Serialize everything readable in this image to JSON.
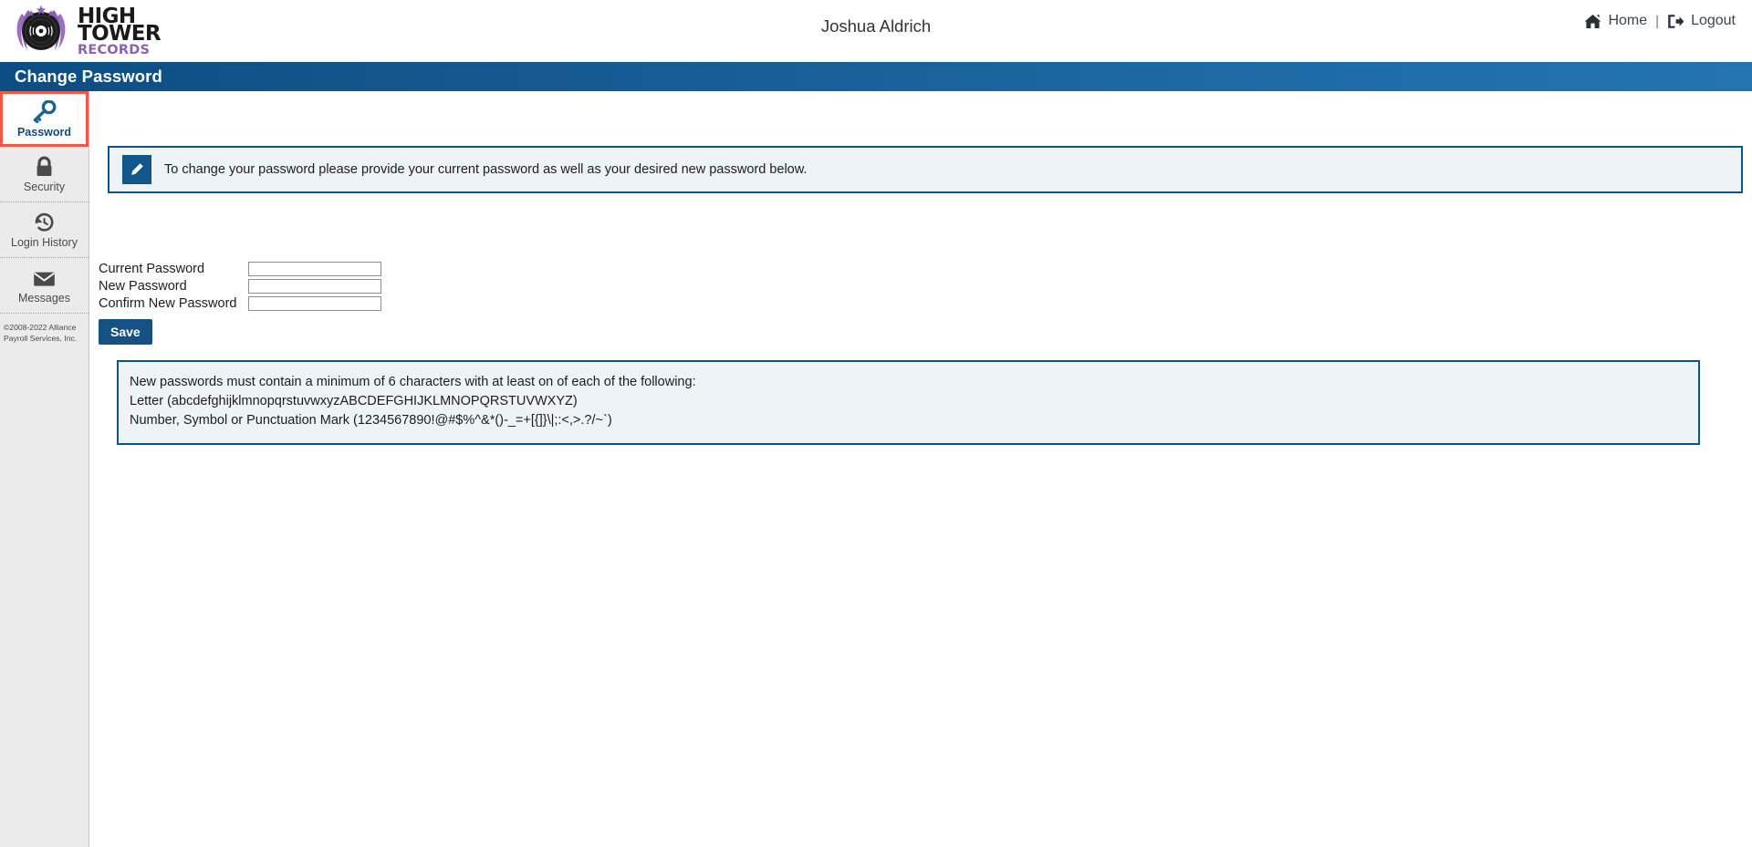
{
  "header": {
    "logo": {
      "line1": "HIGH",
      "line2": "TOWER",
      "line3": "RECORDS",
      "icon": "vinyl-record-icon",
      "purple": "#8a63ad"
    },
    "user_name": "Joshua Aldrich",
    "home_label": "Home",
    "home_icon": "home-icon",
    "divider": "|",
    "logout_label": "Logout",
    "logout_icon": "logout-icon"
  },
  "page": {
    "title": "Change Password",
    "title_bar_color": "#0c4d84"
  },
  "sidebar": {
    "items": [
      {
        "label": "Password",
        "icon": "key-icon",
        "active": true
      },
      {
        "label": "Security",
        "icon": "lock-icon",
        "active": false
      },
      {
        "label": "Login History",
        "icon": "history-clock-icon",
        "active": false
      },
      {
        "label": "Messages",
        "icon": "envelope-icon",
        "active": false
      }
    ],
    "active_outline_color": "#f4564a",
    "copyright": "©2008-2022 Alliance Payroll Services, Inc."
  },
  "banner": {
    "icon": "pencil-edit-icon",
    "text": "To change your password please provide your current password as well as your desired new password below.",
    "border_color": "#0d5487",
    "fill_color": "#eef3f8"
  },
  "form": {
    "fields": [
      {
        "label": "Current Password",
        "value": "",
        "placeholder": ""
      },
      {
        "label": "New Password",
        "value": "",
        "placeholder": ""
      },
      {
        "label": "Confirm New Password",
        "value": "",
        "placeholder": ""
      }
    ],
    "save_label": "Save",
    "save_color": "#165184"
  },
  "requirements": {
    "lines": [
      "New passwords must contain a minimum of 6 characters with at least on of each of the following:",
      "Letter (abcdefghijklmnopqrstuvwxyzABCDEFGHIJKLMNOPQRSTUVWXYZ)",
      "Number, Symbol or Punctuation Mark (1234567890!@#$%^&*()-_=+[{]}\\|;:<,>.?/~`)"
    ],
    "border_color": "#0d5487",
    "fill_color": "#eef3f8"
  }
}
